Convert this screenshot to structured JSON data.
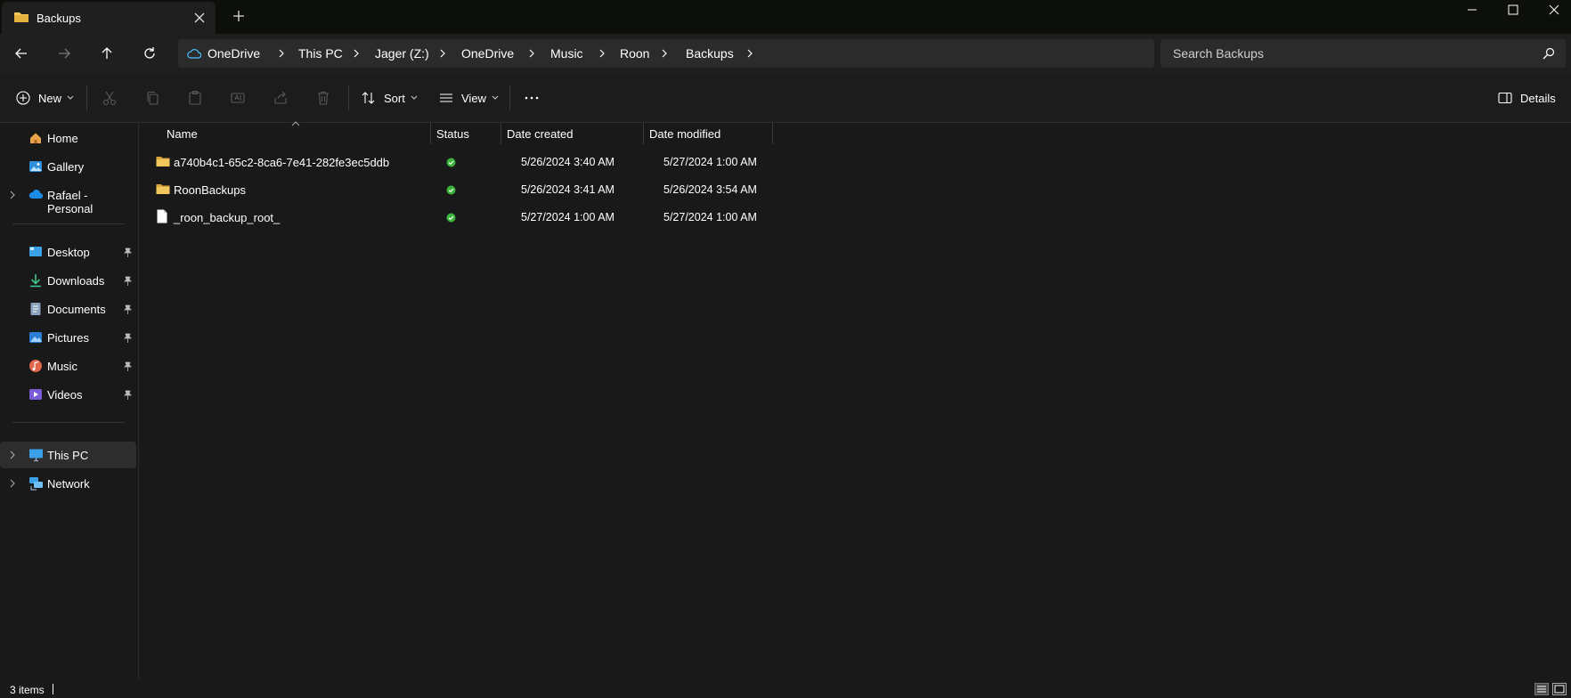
{
  "window": {
    "tab_title": "Backups",
    "tab_close_icon": "close-icon",
    "new_tab_icon": "plus-icon",
    "controls": [
      "minimize-icon",
      "maximize-icon",
      "close-icon"
    ]
  },
  "nav": {
    "back_icon": "arrow-left-icon",
    "forward_icon": "arrow-right-icon",
    "up_icon": "arrow-up-icon",
    "refresh_icon": "refresh-icon"
  },
  "breadcrumb": [
    "OneDrive",
    "This PC",
    "Jager (Z:)",
    "OneDrive",
    "Music",
    "Roon",
    "Backups"
  ],
  "search": {
    "placeholder": "Search Backups"
  },
  "commands": {
    "new_label": "New",
    "sort_label": "Sort",
    "view_label": "View",
    "details_label": "Details",
    "disabled_icons": [
      "cut-icon",
      "copy-icon",
      "paste-icon",
      "rename-icon",
      "share-icon",
      "delete-icon"
    ]
  },
  "sidebar": {
    "top": [
      {
        "label": "Home",
        "icon": "home-icon"
      },
      {
        "label": "Gallery",
        "icon": "gallery-icon"
      },
      {
        "label": "Rafael - Personal",
        "icon": "cloud-icon"
      }
    ],
    "pinned": [
      {
        "label": "Desktop",
        "icon": "desktop-icon"
      },
      {
        "label": "Downloads",
        "icon": "download-icon"
      },
      {
        "label": "Documents",
        "icon": "documents-icon"
      },
      {
        "label": "Pictures",
        "icon": "pictures-icon"
      },
      {
        "label": "Music",
        "icon": "music-icon"
      },
      {
        "label": "Videos",
        "icon": "videos-icon"
      }
    ],
    "bottom": [
      {
        "label": "This PC",
        "icon": "pc-icon"
      },
      {
        "label": "Network",
        "icon": "network-icon"
      }
    ]
  },
  "columns": {
    "name": "Name",
    "status": "Status",
    "created": "Date created",
    "modified": "Date modified"
  },
  "files": [
    {
      "name": "a740b4c1-65c2-8ca6-7e41-282fe3ec5ddb",
      "type": "folder",
      "status": "synced",
      "created": "5/26/2024 3:40 AM",
      "modified": "5/27/2024 1:00 AM"
    },
    {
      "name": "RoonBackups",
      "type": "folder",
      "status": "synced",
      "created": "5/26/2024 3:41 AM",
      "modified": "5/26/2024 3:54 AM"
    },
    {
      "name": "_roon_backup_root_",
      "type": "file",
      "status": "synced",
      "created": "5/27/2024 1:00 AM",
      "modified": "5/27/2024 1:00 AM"
    }
  ],
  "statusbar": {
    "count": "3 items"
  },
  "colors": {
    "folder": "#f2c75c",
    "synced": "#3bb33b",
    "accent": "#4cc2ff"
  }
}
